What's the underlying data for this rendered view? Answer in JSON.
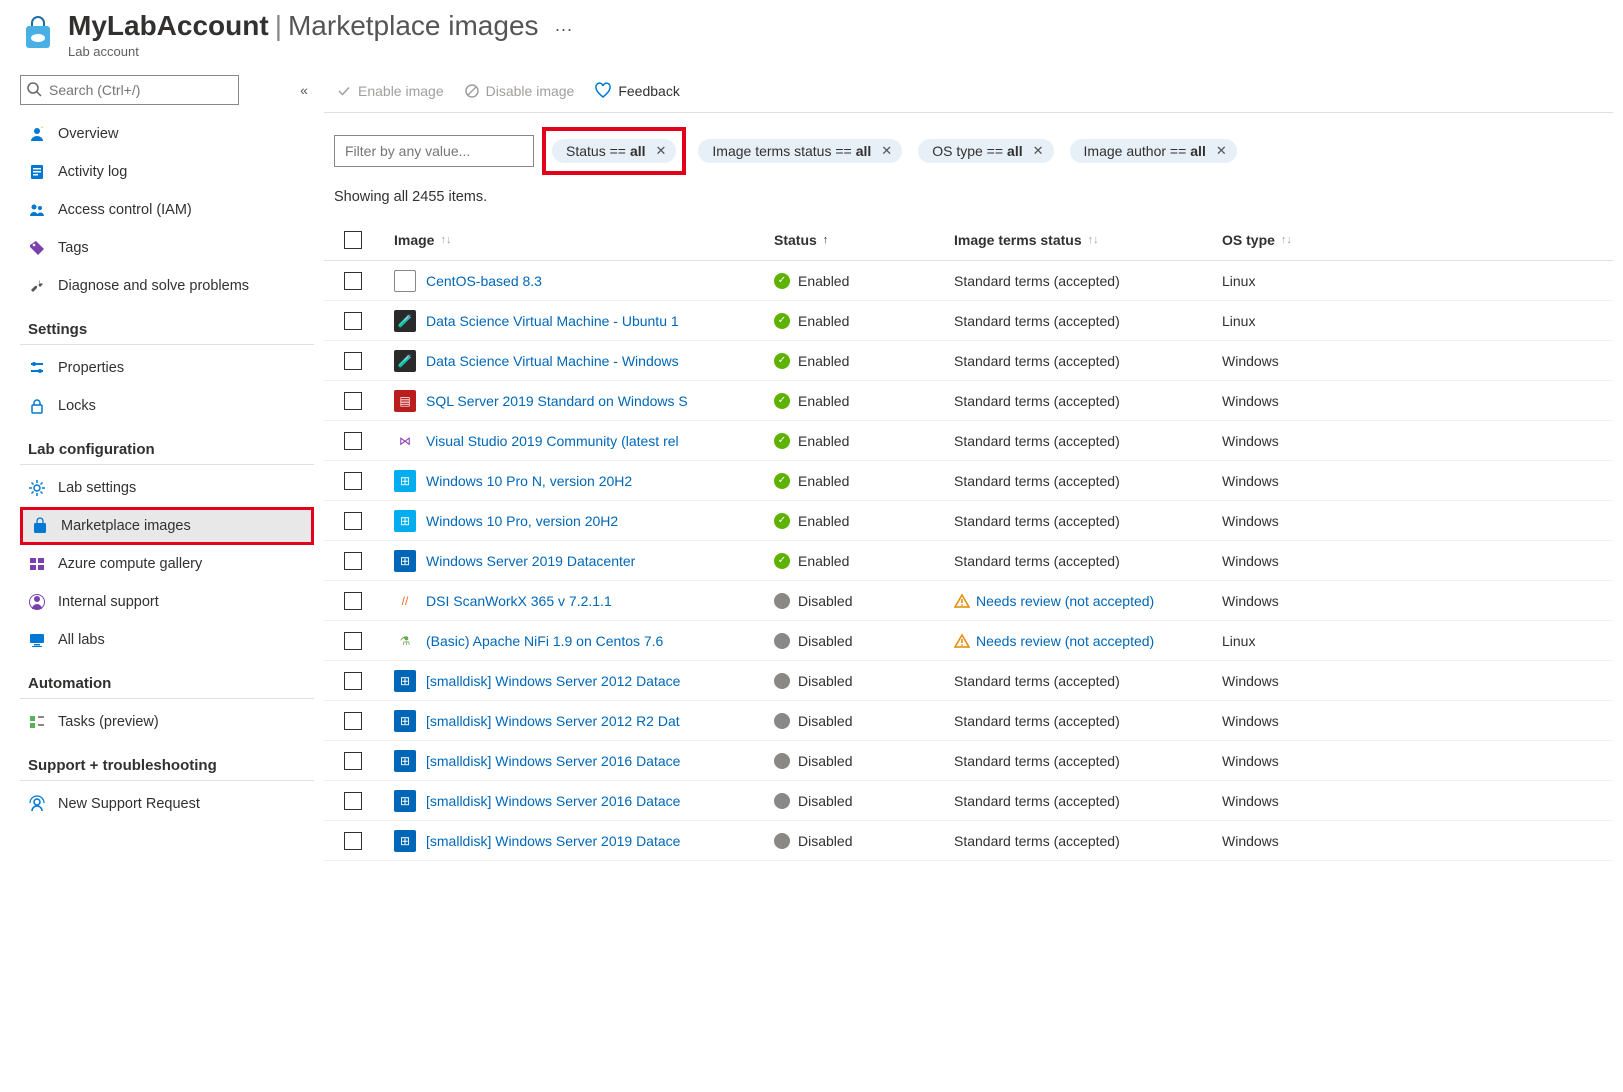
{
  "header": {
    "account": "MyLabAccount",
    "page": "Marketplace images",
    "subtitle": "Lab account",
    "more": "···"
  },
  "sidebar": {
    "search_placeholder": "Search (Ctrl+/)",
    "collapse": "«",
    "top": [
      {
        "key": "overview",
        "label": "Overview"
      },
      {
        "key": "activity-log",
        "label": "Activity log"
      },
      {
        "key": "access-control",
        "label": "Access control (IAM)"
      },
      {
        "key": "tags",
        "label": "Tags"
      },
      {
        "key": "diagnose",
        "label": "Diagnose and solve problems"
      }
    ],
    "sections": [
      {
        "title": "Settings",
        "items": [
          {
            "key": "properties",
            "label": "Properties"
          },
          {
            "key": "locks",
            "label": "Locks"
          }
        ]
      },
      {
        "title": "Lab configuration",
        "items": [
          {
            "key": "lab-settings",
            "label": "Lab settings"
          },
          {
            "key": "marketplace-images",
            "label": "Marketplace images",
            "active": true,
            "highlighted": true
          },
          {
            "key": "azure-compute-gallery",
            "label": "Azure compute gallery"
          },
          {
            "key": "internal-support",
            "label": "Internal support"
          },
          {
            "key": "all-labs",
            "label": "All labs"
          }
        ]
      },
      {
        "title": "Automation",
        "items": [
          {
            "key": "tasks-preview",
            "label": "Tasks (preview)"
          }
        ]
      },
      {
        "title": "Support + troubleshooting",
        "items": [
          {
            "key": "new-support-request",
            "label": "New Support Request"
          }
        ]
      }
    ]
  },
  "toolbar": {
    "enable_label": "Enable image",
    "disable_label": "Disable image",
    "feedback_label": "Feedback"
  },
  "filters": {
    "filter_placeholder": "Filter by any value...",
    "pills": [
      {
        "field": "Status",
        "op": "==",
        "value": "all",
        "highlighted": true
      },
      {
        "field": "Image terms status",
        "op": "==",
        "value": "all"
      },
      {
        "field": "OS type",
        "op": "==",
        "value": "all"
      },
      {
        "field": "Image author",
        "op": "==",
        "value": "all"
      }
    ]
  },
  "showing": "Showing all 2455 items.",
  "columns": {
    "image": "Image",
    "status": "Status",
    "terms": "Image terms status",
    "os": "OS type"
  },
  "rows": [
    {
      "icon_bg": "#fff",
      "icon_border": "#888",
      "icon_txt": "◎",
      "name": "CentOS-based 8.3",
      "status": "Enabled",
      "terms": "Standard terms (accepted)",
      "terms_warn": false,
      "os": "Linux"
    },
    {
      "icon_bg": "#2a2a2a",
      "icon_txt": "🧪",
      "name": "Data Science Virtual Machine - Ubuntu 1",
      "status": "Enabled",
      "terms": "Standard terms (accepted)",
      "terms_warn": false,
      "os": "Linux"
    },
    {
      "icon_bg": "#2a2a2a",
      "icon_txt": "🧪",
      "name": "Data Science Virtual Machine - Windows",
      "status": "Enabled",
      "terms": "Standard terms (accepted)",
      "terms_warn": false,
      "os": "Windows"
    },
    {
      "icon_bg": "#b91d1d",
      "icon_txt": "▤",
      "name": "SQL Server 2019 Standard on Windows S",
      "status": "Enabled",
      "terms": "Standard terms (accepted)",
      "terms_warn": false,
      "os": "Windows"
    },
    {
      "icon_bg": "#fff",
      "icon_txt": "⋈",
      "icon_color": "#8b3db5",
      "name": "Visual Studio 2019 Community (latest rel",
      "status": "Enabled",
      "terms": "Standard terms (accepted)",
      "terms_warn": false,
      "os": "Windows"
    },
    {
      "icon_bg": "#00adef",
      "icon_txt": "⊞",
      "name": "Windows 10 Pro N, version 20H2",
      "status": "Enabled",
      "terms": "Standard terms (accepted)",
      "terms_warn": false,
      "os": "Windows"
    },
    {
      "icon_bg": "#00adef",
      "icon_txt": "⊞",
      "name": "Windows 10 Pro, version 20H2",
      "status": "Enabled",
      "terms": "Standard terms (accepted)",
      "terms_warn": false,
      "os": "Windows"
    },
    {
      "icon_bg": "#0067b8",
      "icon_txt": "⊞",
      "name": "Windows Server 2019 Datacenter",
      "status": "Enabled",
      "terms": "Standard terms (accepted)",
      "terms_warn": false,
      "os": "Windows"
    },
    {
      "icon_bg": "#fff",
      "icon_txt": "//",
      "icon_color": "#f26b1d",
      "name": "DSI ScanWorkX 365 v 7.2.1.1",
      "status": "Disabled",
      "terms": "Needs review (not accepted)",
      "terms_warn": true,
      "os": "Windows"
    },
    {
      "icon_bg": "#fff",
      "icon_txt": "⚗",
      "icon_color": "#6aa84f",
      "name": "(Basic) Apache NiFi 1.9 on Centos 7.6",
      "status": "Disabled",
      "terms": "Needs review (not accepted)",
      "terms_warn": true,
      "os": "Linux"
    },
    {
      "icon_bg": "#0067b8",
      "icon_txt": "⊞",
      "name": "[smalldisk] Windows Server 2012 Datace",
      "status": "Disabled",
      "terms": "Standard terms (accepted)",
      "terms_warn": false,
      "os": "Windows"
    },
    {
      "icon_bg": "#0067b8",
      "icon_txt": "⊞",
      "name": "[smalldisk] Windows Server 2012 R2 Dat",
      "status": "Disabled",
      "terms": "Standard terms (accepted)",
      "terms_warn": false,
      "os": "Windows"
    },
    {
      "icon_bg": "#0067b8",
      "icon_txt": "⊞",
      "name": "[smalldisk] Windows Server 2016 Datace",
      "status": "Disabled",
      "terms": "Standard terms (accepted)",
      "terms_warn": false,
      "os": "Windows"
    },
    {
      "icon_bg": "#0067b8",
      "icon_txt": "⊞",
      "name": "[smalldisk] Windows Server 2016 Datace",
      "status": "Disabled",
      "terms": "Standard terms (accepted)",
      "terms_warn": false,
      "os": "Windows"
    },
    {
      "icon_bg": "#0067b8",
      "icon_txt": "⊞",
      "name": "[smalldisk] Windows Server 2019 Datace",
      "status": "Disabled",
      "terms": "Standard terms (accepted)",
      "terms_warn": false,
      "os": "Windows"
    }
  ],
  "nav_icons": {
    "overview": {
      "color": "#0078d4",
      "glyph": "person"
    },
    "activity-log": {
      "color": "#0078d4",
      "glyph": "log"
    },
    "access-control": {
      "color": "#0078d4",
      "glyph": "people"
    },
    "tags": {
      "color": "#7b40b0",
      "glyph": "tag"
    },
    "diagnose": {
      "color": "#555",
      "glyph": "wrench"
    },
    "properties": {
      "color": "#0078d4",
      "glyph": "sliders"
    },
    "locks": {
      "color": "#0078d4",
      "glyph": "lock"
    },
    "lab-settings": {
      "color": "#0078d4",
      "glyph": "gear"
    },
    "marketplace-images": {
      "color": "#0078d4",
      "glyph": "bag"
    },
    "azure-compute-gallery": {
      "color": "#7b40b0",
      "glyph": "gallery"
    },
    "internal-support": {
      "color": "#7b40b0",
      "glyph": "support"
    },
    "all-labs": {
      "color": "#0078d4",
      "glyph": "monitor"
    },
    "tasks-preview": {
      "color": "#58b158",
      "glyph": "tasks"
    },
    "new-support-request": {
      "color": "#0078d4",
      "glyph": "support2"
    }
  }
}
